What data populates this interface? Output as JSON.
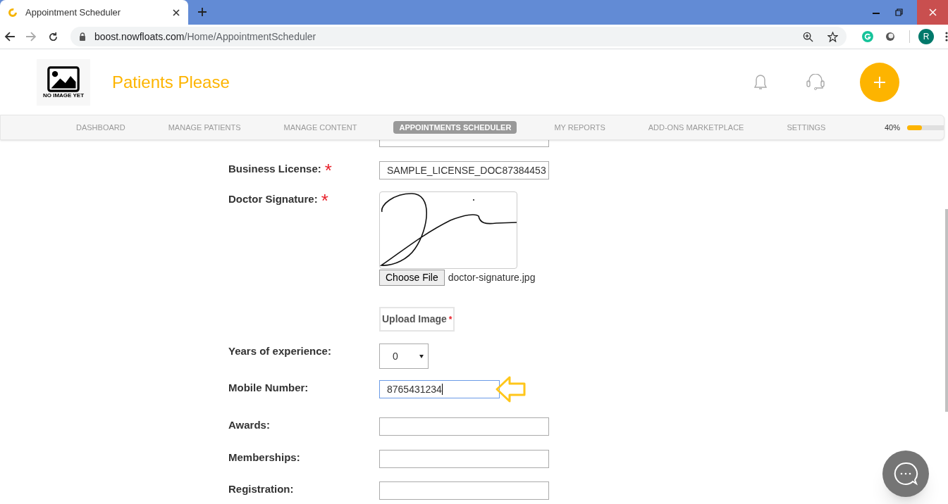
{
  "browser": {
    "tab_title": "Appointment Scheduler",
    "url_domain": "boost.nowfloats.com",
    "url_path": "/Home/AppointmentScheduler",
    "profile_initial": "R"
  },
  "header": {
    "logo_caption": "NO IMAGE YET",
    "brand": "Patients Please"
  },
  "nav": {
    "items": [
      {
        "label": "DASHBOARD",
        "selected": false
      },
      {
        "label": "MANAGE PATIENTS",
        "selected": false
      },
      {
        "label": "MANAGE CONTENT",
        "selected": false
      },
      {
        "label": "APPOINTMENTS SCHEDULER",
        "selected": true
      },
      {
        "label": "MY REPORTS",
        "selected": false
      },
      {
        "label": "ADD-ONS MARKETPLACE",
        "selected": false
      },
      {
        "label": "SETTINGS",
        "selected": false
      }
    ],
    "progress": {
      "label": "40%",
      "level": 0.4
    }
  },
  "form": {
    "fields": [
      {
        "kind": "hidden_row"
      },
      {
        "kind": "text",
        "label": "Business License:",
        "required_mark": "*",
        "value": "SAMPLE_LICENSE_DOC87384453",
        "focused": false
      },
      {
        "kind": "signature",
        "label": "Doctor Signature:",
        "required_mark": "*",
        "button": "Choose File",
        "file_name": "doctor-signature.jpg",
        "upload_button": "Upload Image",
        "upload_mark": "*"
      },
      {
        "kind": "select",
        "label": "Years of experience:",
        "value": "0"
      },
      {
        "kind": "text",
        "label": "Mobile Number:",
        "value": "8765431234",
        "focused": true,
        "callout": true
      },
      {
        "kind": "text",
        "label": "Awards:",
        "focused": false
      },
      {
        "kind": "text",
        "label": "Memberships:",
        "focused": false
      },
      {
        "kind": "text",
        "label": "Registration:",
        "focused": false
      }
    ]
  }
}
